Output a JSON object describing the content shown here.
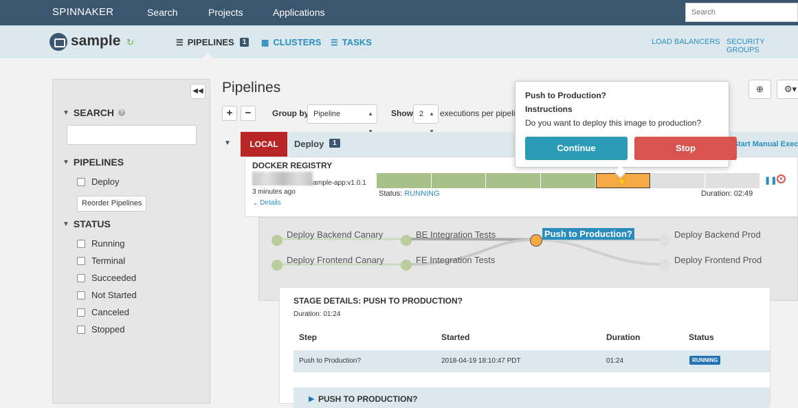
{
  "nav": {
    "brand": "SPINNAKER",
    "links": [
      "Search",
      "Projects",
      "Applications"
    ],
    "search_placeholder": "Search"
  },
  "app": {
    "name": "sample",
    "tabs": [
      {
        "label": "PIPELINES",
        "badge": "1",
        "icon": "list-icon"
      },
      {
        "label": "CLUSTERS",
        "icon": "grid-icon"
      },
      {
        "label": "TASKS",
        "icon": "list-icon"
      }
    ],
    "right_links": [
      "LOAD BALANCERS",
      "SECURITY GROUPS"
    ]
  },
  "sidebar": {
    "search_heading": "SEARCH",
    "pipelines_heading": "PIPELINES",
    "pipelines": [
      "Deploy"
    ],
    "reorder_label": "Reorder Pipelines",
    "status_heading": "STATUS",
    "statuses": [
      "Running",
      "Terminal",
      "Succeeded",
      "Not Started",
      "Canceled",
      "Stopped"
    ]
  },
  "main": {
    "title": "Pipelines",
    "group_by_label": "Group by",
    "group_by_value": "Pipeline",
    "show_label": "Show",
    "show_value": "2",
    "exec_text": "executions per pipeline"
  },
  "group": {
    "badge": "LOCAL",
    "name": "Deploy",
    "count": "1",
    "start_manual": "Start Manual Execution"
  },
  "execution": {
    "trigger": "DOCKER REGISTRY",
    "image": "1d..e1..f..e3..02..0/sample-app:v1.0.1",
    "image_visible": "1d..e1..f..e3..02..0/sample-app:v1.0.1",
    "time_ago": "3 minutes ago",
    "details": "Details",
    "status_label": "Status:",
    "status_value": "RUNNING",
    "duration_label": "Duration: 02:49",
    "segments": [
      "ok",
      "ok",
      "ok",
      "ok",
      "run",
      "na",
      "na"
    ]
  },
  "graph": {
    "nodes": [
      "Deploy Backend Canary",
      "Deploy Frontend Canary",
      "BE Integration Tests",
      "FE Integration Tests",
      "Push to Production?",
      "Deploy Backend Prod",
      "Deploy Frontend Prod"
    ]
  },
  "stage": {
    "title": "STAGE DETAILS: PUSH TO PRODUCTION?",
    "duration": "Duration: 01:24",
    "headers": [
      "Step",
      "Started",
      "Duration",
      "Status"
    ],
    "row": {
      "step": "Push to Production?",
      "started": "2018-04-19 18:10:47 PDT",
      "duration": "01:24",
      "status": "RUNNING"
    },
    "sub_heading": "PUSH TO PRODUCTION?"
  },
  "popover": {
    "title": "Push to Production?",
    "instructions_heading": "Instructions",
    "instructions": "Do you want to deploy this image to production?",
    "continue_label": "Continue",
    "stop_label": "Stop"
  }
}
